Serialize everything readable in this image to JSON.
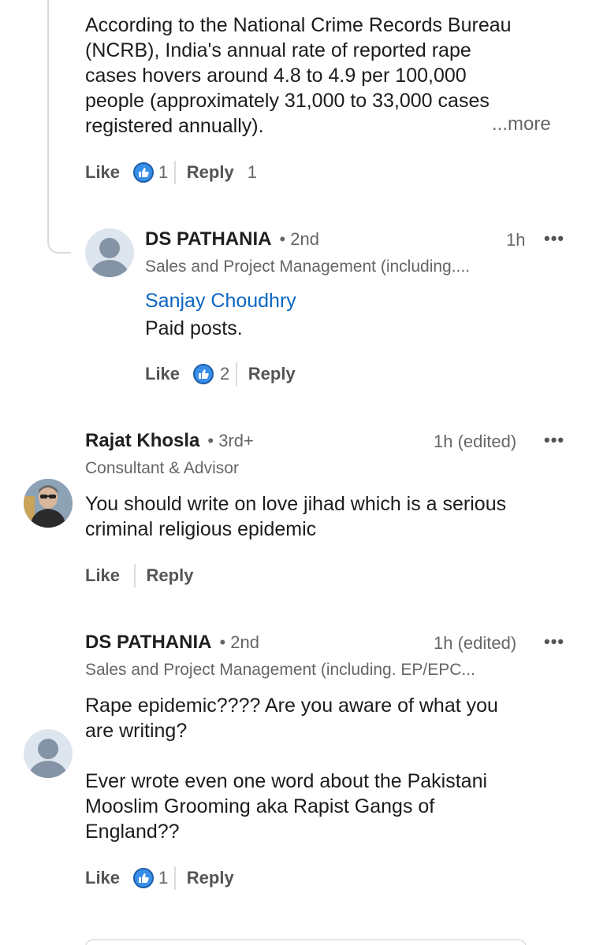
{
  "comment1": {
    "body": "According to the National Crime Records Bureau\n(NCRB), India's annual rate of reported rape\ncases hovers around 4.8 to 4.9 per 100,000\npeople (approximately 31,000 to 33,000 cases\nregistered annually).",
    "more_label": "...more",
    "like_label": "Like",
    "reaction_count": "1",
    "reply_label": "Reply",
    "reply_count": "1"
  },
  "reply1": {
    "author": "DS PATHANIA",
    "degree": "• 2nd",
    "time": "1h",
    "menu": "•••",
    "headline": "Sales and Project Management (including....",
    "mention": "Sanjay Choudhry",
    "body": "Paid posts.",
    "like_label": "Like",
    "reaction_count": "2",
    "reply_label": "Reply"
  },
  "comment2": {
    "author": "Rajat Khosla",
    "degree": "• 3rd+",
    "time": "1h (edited)",
    "menu": "•••",
    "headline": "Consultant & Advisor",
    "body": "You should write on love jihad which is a serious\ncriminal religious epidemic",
    "like_label": "Like",
    "reply_label": "Reply"
  },
  "comment3": {
    "author": "DS PATHANIA",
    "degree": "• 2nd",
    "time": "1h (edited)",
    "menu": "•••",
    "headline": "Sales and Project Management (including. EP/EPC...",
    "body": "Rape epidemic???? Are you aware of what you\nare writing?\n\nEver wrote even one word about the Pakistani\nMooslim Grooming aka Rapist Gangs of\nEngland??",
    "like_label": "Like",
    "reaction_count": "1",
    "reply_label": "Reply"
  },
  "icons": {
    "like_reaction": "thumbs-up-icon",
    "avatar_default": "default-person-avatar",
    "menu": "more-options-icon"
  },
  "colors": {
    "link": "#0a66c2",
    "like_badge": "#378fe9",
    "text_secondary": "#666666"
  }
}
